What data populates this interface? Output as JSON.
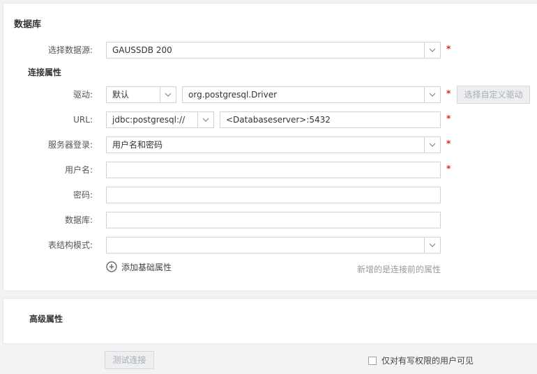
{
  "database_section": {
    "title": "数据库",
    "datasource_label": "选择数据源:",
    "datasource_value": "GAUSSDB 200",
    "connection_title": "连接属性",
    "driver_label": "驱动:",
    "driver_type_value": "默认",
    "driver_class_value": "org.postgresql.Driver",
    "custom_driver_button": "选择自定义驱动",
    "url_label": "URL:",
    "url_prefix_value": "jdbc:postgresql://",
    "url_value": "<Databaseserver>:5432",
    "login_label": "服务器登录:",
    "login_value": "用户名和密码",
    "username_label": "用户名:",
    "username_value": "",
    "password_label": "密码:",
    "password_value": "",
    "database_label": "数据库:",
    "database_value": "",
    "schema_label": "表结构模式:",
    "schema_value": "",
    "add_property_label": "添加基础属性",
    "hint_text": "新增的是连接前的属性",
    "required_mark": "*"
  },
  "advanced_section": {
    "title": "高级属性"
  },
  "footer": {
    "test_button": "测试连接",
    "visibility_checkbox_label": "仅对有写权限的用户可见",
    "visibility_checked": false
  },
  "colors": {
    "required": "#e02020",
    "border": "#cfd3d9",
    "disabled_bg": "#edeef0",
    "disabled_text": "#a9adb3",
    "page_bg": "#f2f3f5"
  },
  "icons": {
    "dropdown": "chevron-down-icon",
    "add": "plus-circle-icon",
    "checkbox": "checkbox-icon"
  }
}
